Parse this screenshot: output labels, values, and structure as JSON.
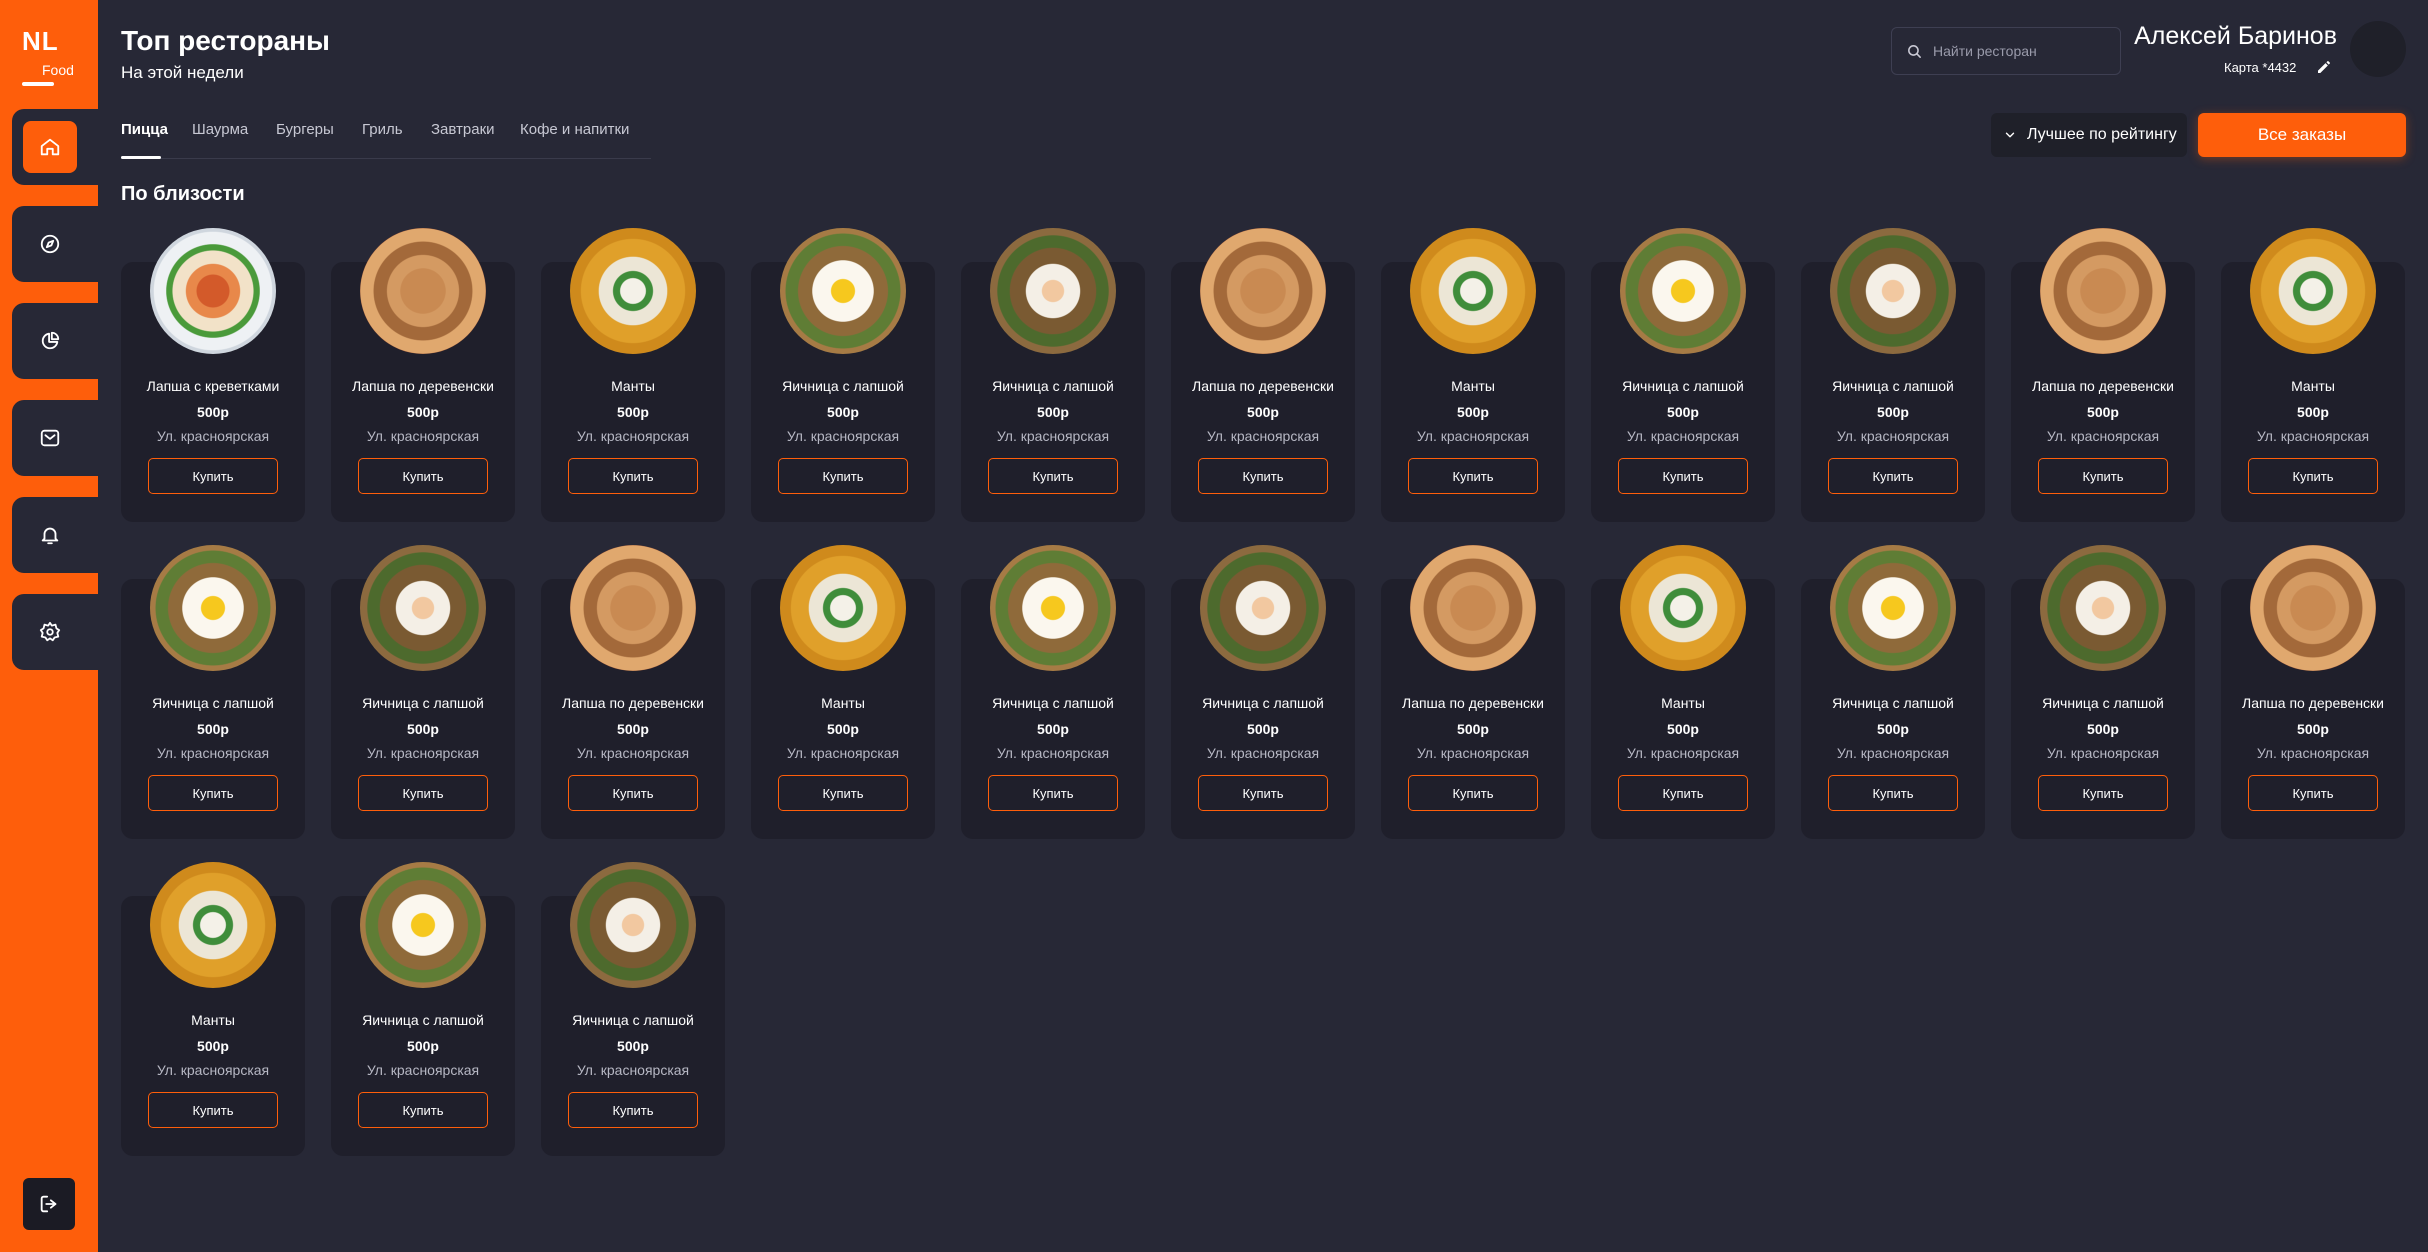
{
  "logo": {
    "main": "NL",
    "sub": "Food"
  },
  "colors": {
    "accent": "#fe5e0b",
    "background": "#272836",
    "card": "#1f1f2b"
  },
  "nav": [
    {
      "name": "home",
      "icon": "home-icon",
      "active": true
    },
    {
      "name": "explore",
      "icon": "compass-icon",
      "active": false
    },
    {
      "name": "stats",
      "icon": "pie-chart-icon",
      "active": false
    },
    {
      "name": "messages",
      "icon": "mail-icon",
      "active": false
    },
    {
      "name": "notifications",
      "icon": "bell-icon",
      "active": false
    },
    {
      "name": "settings",
      "icon": "gear-icon",
      "active": false
    }
  ],
  "header": {
    "title": "Топ рестораны",
    "subtitle": "На этой недели",
    "search_placeholder": "Найти ресторан"
  },
  "user": {
    "name": "Алексей Баринов",
    "card": "Карта *4432"
  },
  "tabs": [
    "Пицца",
    "Шаурма",
    "Бургеры",
    "Гриль",
    "Завтраки",
    "Кофе и напитки"
  ],
  "active_tab": "Пицца",
  "sort_label": "Лучшее по рейтингу",
  "orders_label": "Все заказы",
  "section_title": "По близости",
  "buy_label": "Купить",
  "products": [
    {
      "name": "Лапша с креветками",
      "price": "500р",
      "address": "Ул. красноярская",
      "dish": "shrimp"
    },
    {
      "name": "Лапша по деревенски",
      "price": "500р",
      "address": "Ул. красноярская",
      "dish": "noodles"
    },
    {
      "name": "Манты",
      "price": "500р",
      "address": "Ул. красноярская",
      "dish": "manty"
    },
    {
      "name": "Яичница с лапшой",
      "price": "500р",
      "address": "Ул. красноярская",
      "dish": "egg"
    },
    {
      "name": "Яичница с лапшой",
      "price": "500р",
      "address": "Ул. красноярская",
      "dish": "eggwhite"
    },
    {
      "name": "Лапша по деревенски",
      "price": "500р",
      "address": "Ул. красноярская",
      "dish": "noodles"
    },
    {
      "name": "Манты",
      "price": "500р",
      "address": "Ул. красноярская",
      "dish": "manty"
    },
    {
      "name": "Яичница с лапшой",
      "price": "500р",
      "address": "Ул. красноярская",
      "dish": "egg"
    },
    {
      "name": "Яичница с лапшой",
      "price": "500р",
      "address": "Ул. красноярская",
      "dish": "eggwhite"
    },
    {
      "name": "Лапша по деревенски",
      "price": "500р",
      "address": "Ул. красноярская",
      "dish": "noodles"
    },
    {
      "name": "Манты",
      "price": "500р",
      "address": "Ул. красноярская",
      "dish": "manty"
    },
    {
      "name": "Яичница с лапшой",
      "price": "500р",
      "address": "Ул. красноярская",
      "dish": "egg"
    },
    {
      "name": "Яичница с лапшой",
      "price": "500р",
      "address": "Ул. красноярская",
      "dish": "eggwhite"
    },
    {
      "name": "Лапша по деревенски",
      "price": "500р",
      "address": "Ул. красноярская",
      "dish": "noodles"
    },
    {
      "name": "Манты",
      "price": "500р",
      "address": "Ул. красноярская",
      "dish": "manty"
    },
    {
      "name": "Яичница с лапшой",
      "price": "500р",
      "address": "Ул. красноярская",
      "dish": "egg"
    },
    {
      "name": "Яичница с лапшой",
      "price": "500р",
      "address": "Ул. красноярская",
      "dish": "eggwhite"
    },
    {
      "name": "Лапша по деревенски",
      "price": "500р",
      "address": "Ул. красноярская",
      "dish": "noodles"
    },
    {
      "name": "Манты",
      "price": "500р",
      "address": "Ул. красноярская",
      "dish": "manty"
    },
    {
      "name": "Яичница с лапшой",
      "price": "500р",
      "address": "Ул. красноярская",
      "dish": "egg"
    },
    {
      "name": "Яичница с лапшой",
      "price": "500р",
      "address": "Ул. красноярская",
      "dish": "eggwhite"
    },
    {
      "name": "Лапша по деревенски",
      "price": "500р",
      "address": "Ул. красноярская",
      "dish": "noodles"
    },
    {
      "name": "Манты",
      "price": "500р",
      "address": "Ул. красноярская",
      "dish": "manty"
    },
    {
      "name": "Яичница с лапшой",
      "price": "500р",
      "address": "Ул. красноярская",
      "dish": "egg"
    },
    {
      "name": "Яичница с лапшой",
      "price": "500р",
      "address": "Ул. красноярская",
      "dish": "eggwhite"
    }
  ]
}
